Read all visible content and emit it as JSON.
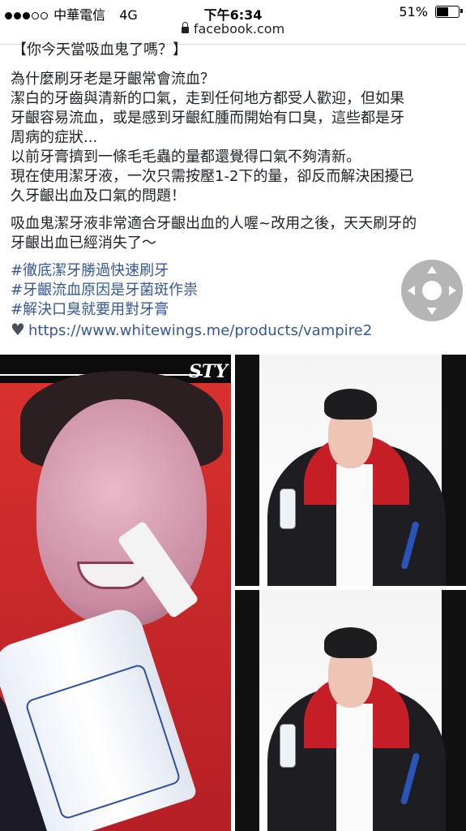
{
  "status_bar": {
    "carrier": "中華電信",
    "network": "4G",
    "time": "下午6:34",
    "battery": "51%"
  },
  "url_bar": {
    "domain": "facebook.com"
  },
  "post": {
    "title": "【你今天當吸血鬼了嗎？】",
    "paragraph1": [
      "為什麼刷牙老是牙齦常會流血？",
      "潔白的牙齒與清新的口氣，走到任何地方都受人歡迎，但如果",
      "牙齦容易流血，或是感到牙齦紅腫而開始有口臭，這些都是牙",
      "周病的症狀...",
      "以前牙膏擠到一條毛毛蟲的量都還覺得口氣不夠清新。",
      "現在使用潔牙液，一次只需按壓1-2下的量，卻反而解決困擾已",
      "久牙齦出血及口氣的問題！"
    ],
    "paragraph2": [
      "吸血鬼潔牙液非常適合牙齦出血的人喔~改用之後，天天刷牙的",
      "牙齦出血已經消失了～"
    ],
    "hashtags": [
      "#徹底潔牙勝過快速刷牙",
      "#牙齦流血原因是牙菌斑作祟",
      "#解決口臭就要用對牙膏"
    ],
    "link_icon": "heart-icon",
    "link": "https://www.whitewings.me/products/vampire2"
  },
  "photos": {
    "banner_text": "STY"
  }
}
